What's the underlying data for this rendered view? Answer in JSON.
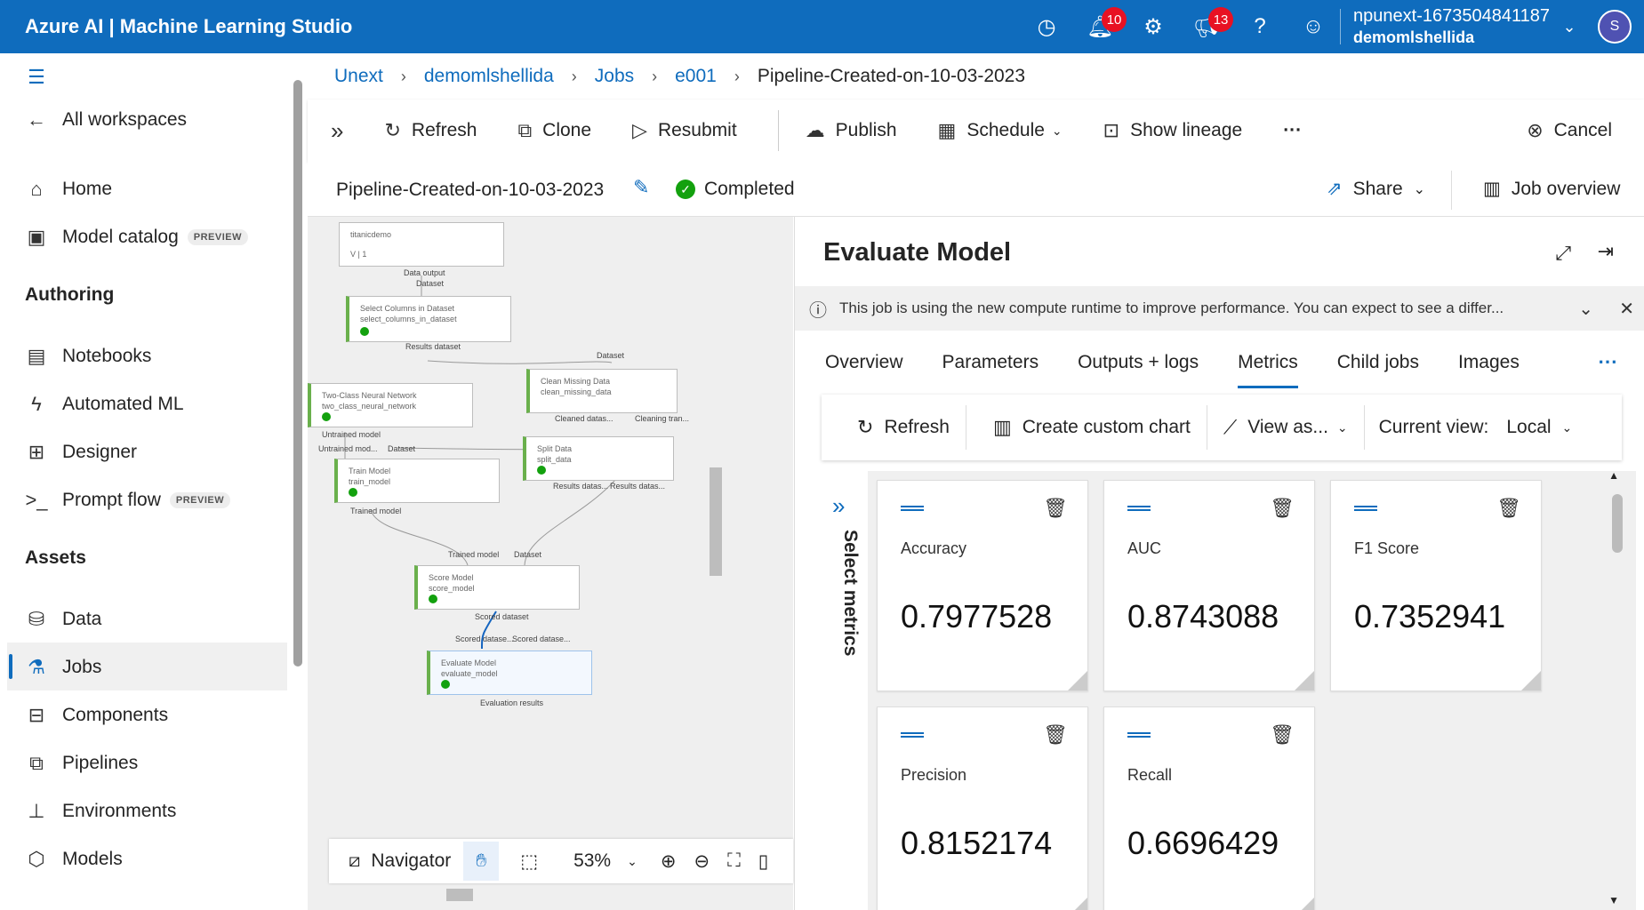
{
  "app": {
    "title": "Azure AI | Machine Learning Studio"
  },
  "topbar": {
    "notifications_count": "10",
    "announcements_count": "13",
    "account_name": "npunext-1673504841187",
    "account_workspace": "demomlshellida",
    "avatar_initial": "S"
  },
  "sidebar": {
    "all_workspaces": "All workspaces",
    "home": "Home",
    "model_catalog": "Model catalog",
    "preview": "PREVIEW",
    "authoring_heading": "Authoring",
    "notebooks": "Notebooks",
    "automated_ml": "Automated ML",
    "designer": "Designer",
    "prompt_flow": "Prompt flow",
    "assets_heading": "Assets",
    "data": "Data",
    "jobs": "Jobs",
    "components": "Components",
    "pipelines": "Pipelines",
    "environments": "Environments",
    "models": "Models"
  },
  "breadcrumb": [
    "Unext",
    "demomlshellida",
    "Jobs",
    "e001",
    "Pipeline-Created-on-10-03-2023"
  ],
  "toolbar": {
    "refresh": "Refresh",
    "clone": "Clone",
    "resubmit": "Resubmit",
    "publish": "Publish",
    "schedule": "Schedule",
    "show_lineage": "Show lineage",
    "more": "···",
    "cancel": "Cancel"
  },
  "pipeline": {
    "name": "Pipeline-Created-on-10-03-2023",
    "status": "Completed",
    "share": "Share",
    "job_overview": "Job overview"
  },
  "canvas": {
    "nodes": {
      "titanic": {
        "title": "titanicdemo",
        "sub": "V | 1"
      },
      "select_cols": {
        "title": "Select Columns in Dataset",
        "sub": "select_columns_in_dataset"
      },
      "clean": {
        "title": "Clean Missing Data",
        "sub": "clean_missing_data"
      },
      "nn": {
        "title": "Two-Class Neural Network",
        "sub": "two_class_neural_network"
      },
      "split": {
        "title": "Split Data",
        "sub": "split_data"
      },
      "train": {
        "title": "Train Model",
        "sub": "train_model"
      },
      "score": {
        "title": "Score Model",
        "sub": "score_model"
      },
      "evaluate": {
        "title": "Evaluate Model",
        "sub": "evaluate_model"
      }
    },
    "labels": {
      "data_output": "Data output",
      "dataset": "Dataset",
      "results_dataset": "Results dataset",
      "untrained_model": "Untrained model",
      "cleaned_datas": "Cleaned datas...",
      "cleaning_tran": "Cleaning tran...",
      "untrained_mod": "Untrained mod...",
      "results_datas": "Results datas...",
      "trained_model": "Trained model",
      "scored_dataset": "Scored dataset",
      "scored_datase_1": "Scored datase...",
      "scored_datase_2": "Scored datase...",
      "evaluation_results": "Evaluation results"
    },
    "navigator": "Navigator",
    "zoom": "53%"
  },
  "panel": {
    "title": "Evaluate Model",
    "info": "This job is using the new compute runtime to improve performance. You can expect to see a differ...",
    "tabs": [
      "Overview",
      "Parameters",
      "Outputs + logs",
      "Metrics",
      "Child jobs",
      "Images"
    ],
    "active_tab": "Metrics",
    "metrics_toolbar": {
      "refresh": "Refresh",
      "create_chart": "Create custom chart",
      "view_as": "View as...",
      "current_view_label": "Current view:",
      "current_view": "Local"
    },
    "select_metrics": "Select metrics",
    "metrics": [
      {
        "name": "Accuracy",
        "value": "0.7977528"
      },
      {
        "name": "AUC",
        "value": "0.8743088"
      },
      {
        "name": "F1 Score",
        "value": "0.7352941"
      },
      {
        "name": "Precision",
        "value": "0.8152174"
      },
      {
        "name": "Recall",
        "value": "0.6696429"
      }
    ]
  }
}
